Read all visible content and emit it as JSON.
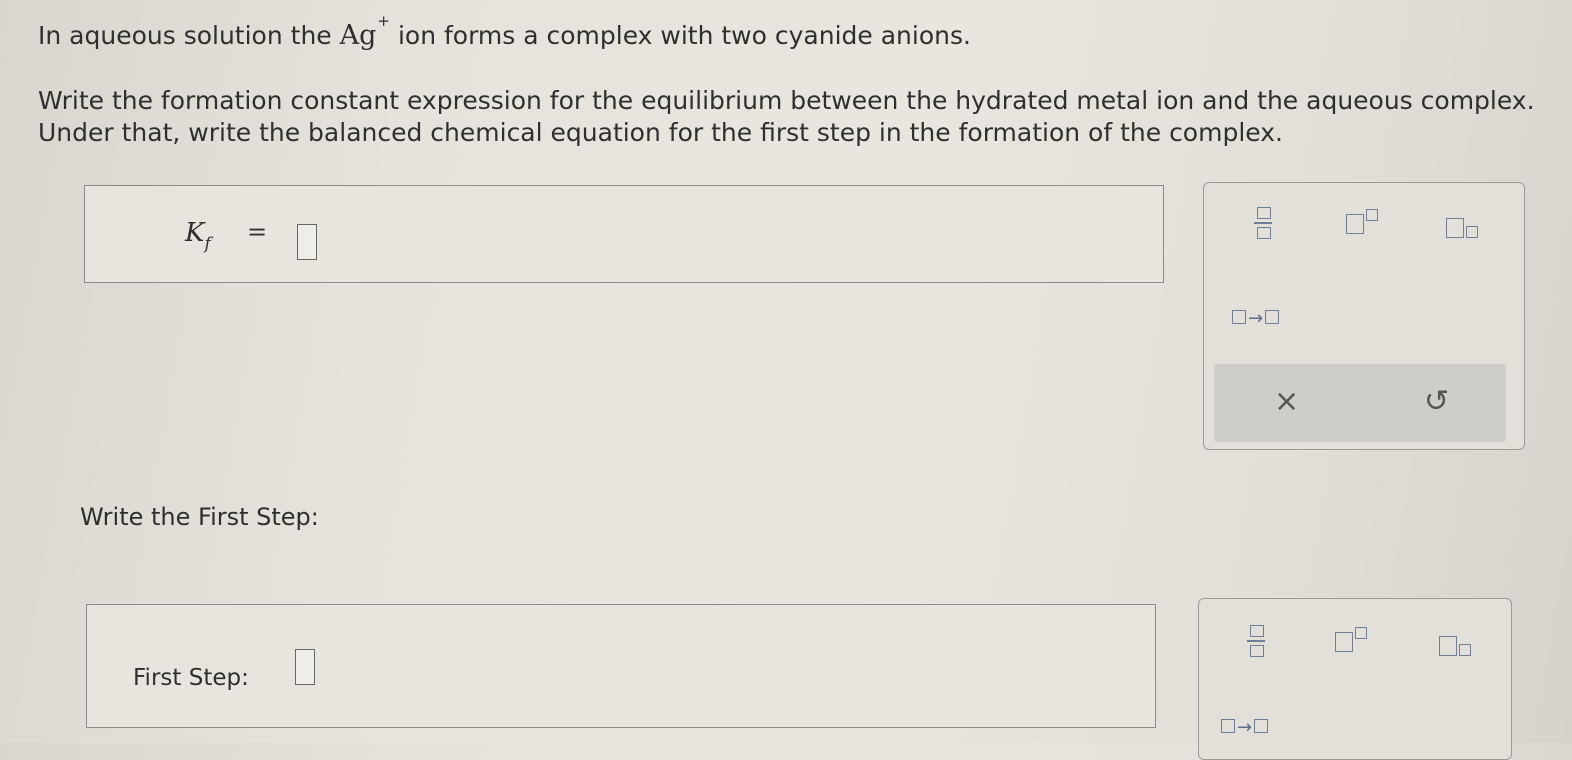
{
  "question": {
    "intro_before": "In aqueous solution the ",
    "ion_symbol": "Ag",
    "ion_charge": "+",
    "intro_after": " ion forms a complex with two cyanide anions.",
    "instruction_line1": "Write the formation constant expression for the equilibrium between the hydrated metal ion and the aqueous complex.",
    "instruction_line2": "Under that, write the balanced chemical equation for the first step in the formation of the complex."
  },
  "kf_answer": {
    "symbol": "K",
    "subscript": "f",
    "equals": "="
  },
  "first_step": {
    "heading": "Write the First Step:",
    "label": "First Step:"
  },
  "palette": {
    "tools": [
      "fraction-icon",
      "superscript-icon",
      "subscript-icon",
      "reaction-arrow-icon"
    ],
    "clear_symbol": "×",
    "undo_symbol": "↺"
  }
}
